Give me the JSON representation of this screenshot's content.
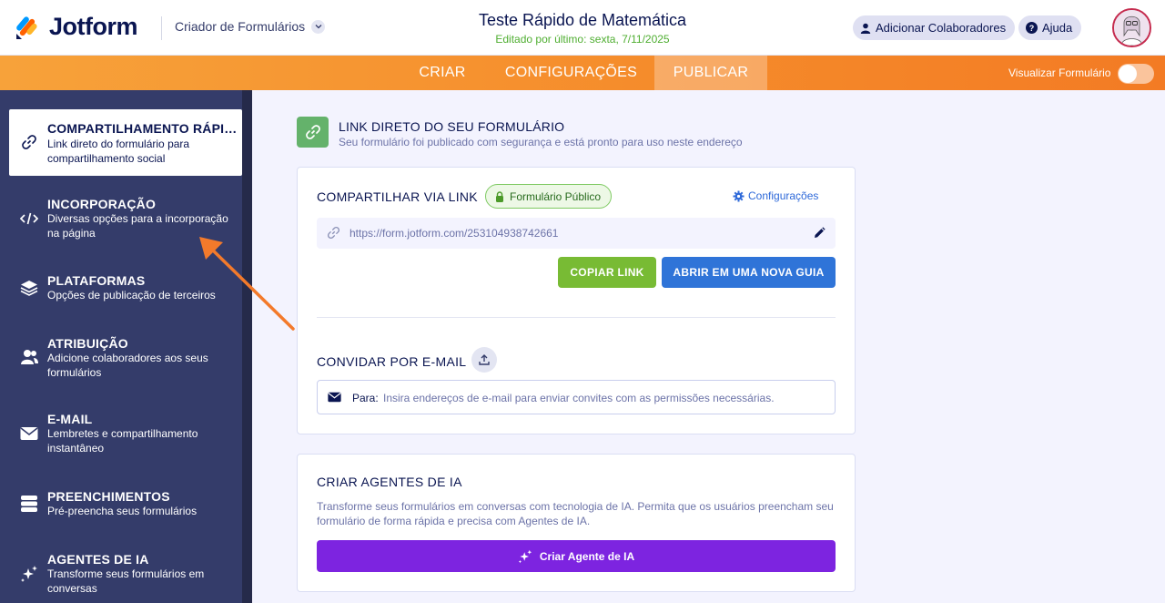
{
  "header": {
    "logo_text": "Jotform",
    "builder_label": "Criador de Formulários",
    "form_title": "Teste Rápido de Matemática",
    "last_edited": "Editado por último: sexta, 7/11/2025",
    "add_collaborators": "Adicionar Colaboradores",
    "help": "Ajuda"
  },
  "nav": {
    "tabs": [
      {
        "label": "CRIAR"
      },
      {
        "label": "CONFIGURAÇÕES"
      },
      {
        "label": "PUBLICAR"
      }
    ],
    "active_tab": "PUBLICAR",
    "preview_label": "Visualizar Formulário",
    "preview_toggle_on": false
  },
  "sidebar": {
    "items": [
      {
        "title": "COMPARTILHAMENTO RÁPIDO",
        "desc": "Link direto do formulário para compartilhamento social",
        "icon": "link-icon"
      },
      {
        "title": "INCORPORAÇÃO",
        "desc": "Diversas opções para a incorporação na página",
        "icon": "code-icon"
      },
      {
        "title": "PLATAFORMAS",
        "desc": "Opções de publicação de terceiros",
        "icon": "layers-icon"
      },
      {
        "title": "ATRIBUIÇÃO",
        "desc": "Adicione colaboradores aos seus formulários",
        "icon": "users-icon"
      },
      {
        "title": "E-MAIL",
        "desc": "Lembretes e compartilhamento instantâneo",
        "icon": "envelope-icon"
      },
      {
        "title": "PREENCHIMENTOS",
        "desc": "Pré-preencha seus formulários",
        "icon": "prefill-icon"
      },
      {
        "title": "AGENTES DE IA",
        "desc": "Transforme seus formulários em conversas",
        "icon": "sparkle-icon"
      }
    ]
  },
  "main": {
    "header_title": "LINK DIRETO DO SEU FORMULÁRIO",
    "header_sub": "Seu formulário foi publicado com segurança e está pronto para uso neste endereço",
    "share": {
      "title": "COMPARTILHAR VIA LINK",
      "badge": "Formulário Público",
      "settings": "Configurações",
      "url": "https://form.jotform.com/253104938742661",
      "copy_button": "COPIAR LINK",
      "open_button": "ABRIR EM UMA NOVA GUIA"
    },
    "invite": {
      "title": "CONVIDAR POR E-MAIL",
      "to_label": "Para:",
      "placeholder": "Insira endereços de e-mail para enviar convites com as permissões necessárias."
    },
    "ai": {
      "title": "CRIAR AGENTES DE IA",
      "desc": "Transforme seus formulários em conversas com tecnologia de IA. Permita que os usuários preencham seu formulário de forma rápida e precisa com Agentes de IA.",
      "button": "Criar Agente de IA"
    }
  },
  "colors": {
    "brand_orange": "#f58a2a",
    "sidebar_bg": "#343c6a",
    "green_button": "#78bb34",
    "blue_button": "#2f74d8",
    "purple_button": "#7d24e0",
    "arrow": "#f37a2b"
  }
}
